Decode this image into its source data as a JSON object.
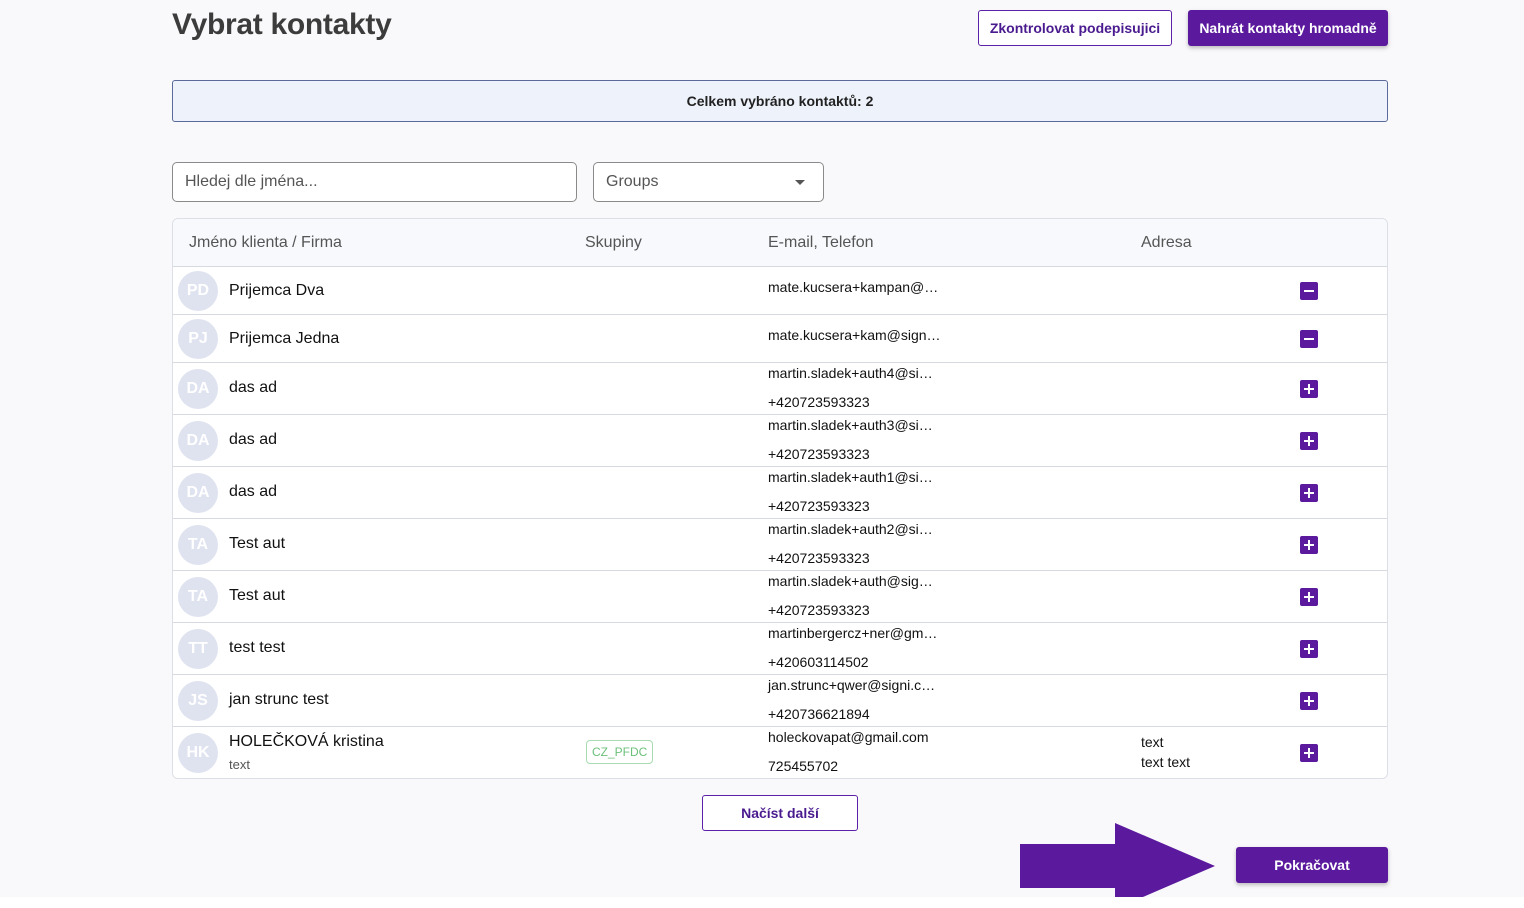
{
  "header": {
    "title": "Vybrat kontakty",
    "check_signers_label": "Zkontrolovat podepisujici",
    "bulk_upload_label": "Nahrát kontakty hromadně"
  },
  "summary": {
    "text": "Celkem vybráno kontaktů: 2"
  },
  "filters": {
    "search_placeholder": "Hledej dle jména...",
    "groups_label": "Groups"
  },
  "table": {
    "columns": {
      "name": "Jméno klienta / Firma",
      "groups": "Skupiny",
      "contact": "E-mail, Telefon",
      "address": "Adresa"
    },
    "rows": [
      {
        "initials": "PD",
        "name": "Prijemca Dva",
        "email": "mate.kucsera+kampan@…",
        "phone": "",
        "selected": true
      },
      {
        "initials": "PJ",
        "name": "Prijemca Jedna",
        "email": "mate.kucsera+kam@sign…",
        "phone": "",
        "selected": true
      },
      {
        "initials": "DA",
        "name": "das ad",
        "email": "martin.sladek+auth4@si…",
        "phone": "+420723593323",
        "selected": false
      },
      {
        "initials": "DA",
        "name": "das ad",
        "email": "martin.sladek+auth3@si…",
        "phone": "+420723593323",
        "selected": false
      },
      {
        "initials": "DA",
        "name": "das ad",
        "email": "martin.sladek+auth1@si…",
        "phone": "+420723593323",
        "selected": false
      },
      {
        "initials": "TA",
        "name": "Test aut",
        "email": "martin.sladek+auth2@si…",
        "phone": "+420723593323",
        "selected": false
      },
      {
        "initials": "TA",
        "name": "Test aut",
        "email": "martin.sladek+auth@sig…",
        "phone": "+420723593323",
        "selected": false
      },
      {
        "initials": "TT",
        "name": "test test",
        "email": "martinbergercz+ner@gm…",
        "phone": "+420603114502",
        "selected": false
      },
      {
        "initials": "JS",
        "name": "jan strunc test",
        "email": "jan.strunc+qwer@signi.c…",
        "phone": "+420736621894",
        "selected": false
      },
      {
        "initials": "HK",
        "name": "HOLEČKOVÁ kristina",
        "subtitle": "text",
        "group_tag": "CZ_PFDC",
        "email": "holeckovapat@gmail.com",
        "phone": "725455702",
        "address_line1": "text",
        "address_line2": "text text",
        "selected": false
      }
    ]
  },
  "load_more_label": "Načíst další",
  "continue_label": "Pokračovat",
  "colors": {
    "primary": "#5b1a9d",
    "avatar_bg": "#dfe3f0",
    "tag_green": "#6cc07a",
    "summary_bg": "#eef3fb"
  }
}
